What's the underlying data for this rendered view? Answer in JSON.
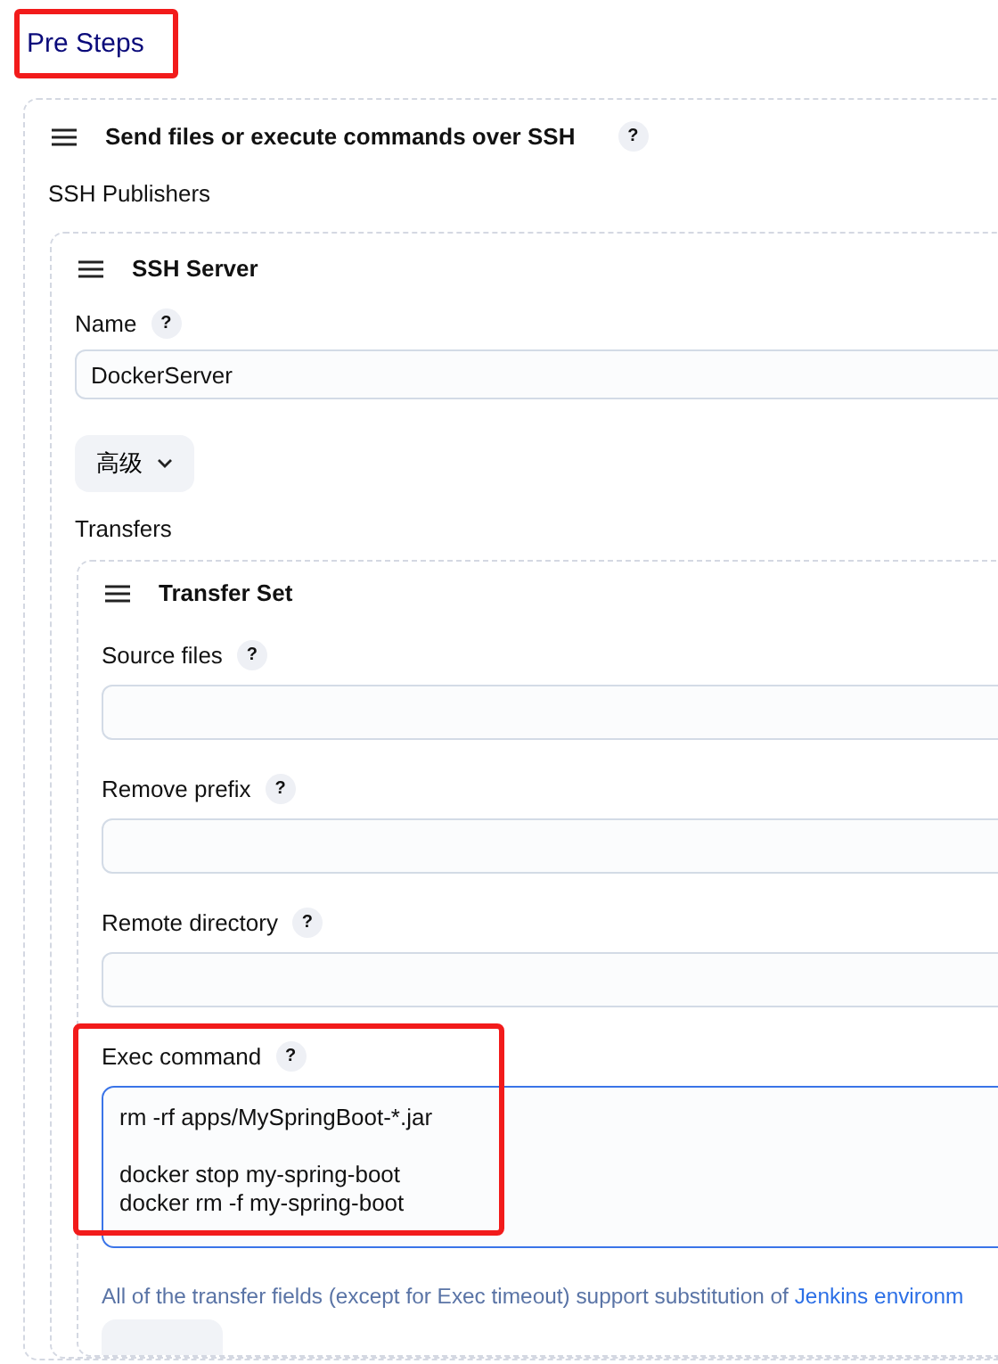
{
  "section": {
    "title": "Pre Steps",
    "highlighted": true
  },
  "step": {
    "title": "Send files or execute commands over SSH",
    "help": "?",
    "subtitle": "SSH Publishers",
    "server": {
      "title": "SSH Server",
      "name_field": {
        "label": "Name",
        "help": "?",
        "value": "DockerServer"
      },
      "advanced_button": {
        "label": "高级"
      },
      "transfers_label": "Transfers",
      "transfer_set": {
        "title": "Transfer Set",
        "fields": [
          {
            "label": "Source files",
            "help": "?",
            "kind": "input",
            "highlighted": false,
            "focused": false
          },
          {
            "label": "Remove prefix",
            "help": "?",
            "kind": "input",
            "highlighted": false,
            "focused": false
          },
          {
            "label": "Remote directory",
            "help": "?",
            "kind": "input",
            "highlighted": false,
            "focused": false
          },
          {
            "label": "Exec command",
            "help": "?",
            "kind": "textarea",
            "highlighted": true,
            "focused": true,
            "value": "rm -rf apps/MySpringBoot-*.jar\n\ndocker stop my-spring-boot\ndocker rm -f my-spring-boot"
          }
        ],
        "note": "All of the transfer fields (except for Exec timeout) support substitution of ",
        "note_link": "Jenkins environm"
      }
    }
  }
}
